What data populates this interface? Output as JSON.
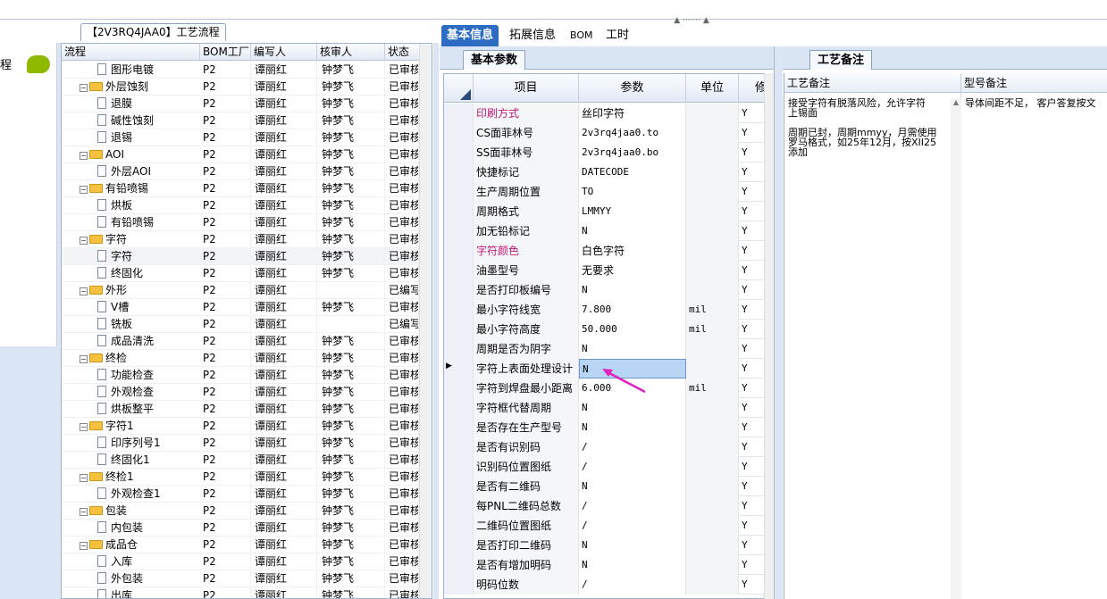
{
  "left_nav": {
    "title": "程"
  },
  "tree": {
    "tab_label": "【2V3RQ4JAA0】工艺流程",
    "columns": [
      "流程",
      "BOM工厂",
      "编写人",
      "核审人",
      "状态"
    ],
    "rows": [
      {
        "name": "图形电镀",
        "level": 2,
        "type": "doc",
        "bom": "P2",
        "writer": "谭丽红",
        "reviewer": "钟梦飞",
        "status": "已审核"
      },
      {
        "name": "外层蚀刻",
        "level": 1,
        "type": "folder",
        "bom": "P2",
        "writer": "谭丽红",
        "reviewer": "钟梦飞",
        "status": "已审核"
      },
      {
        "name": "退膜",
        "level": 2,
        "type": "doc",
        "bom": "P2",
        "writer": "谭丽红",
        "reviewer": "钟梦飞",
        "status": "已审核"
      },
      {
        "name": "碱性蚀刻",
        "level": 2,
        "type": "doc",
        "bom": "P2",
        "writer": "谭丽红",
        "reviewer": "钟梦飞",
        "status": "已审核"
      },
      {
        "name": "退锡",
        "level": 2,
        "type": "doc",
        "bom": "P2",
        "writer": "谭丽红",
        "reviewer": "钟梦飞",
        "status": "已审核"
      },
      {
        "name": "AOI",
        "level": 1,
        "type": "folder",
        "bom": "P2",
        "writer": "谭丽红",
        "reviewer": "钟梦飞",
        "status": "已审核"
      },
      {
        "name": "外层AOI",
        "level": 2,
        "type": "doc",
        "bom": "P2",
        "writer": "谭丽红",
        "reviewer": "钟梦飞",
        "status": "已审核"
      },
      {
        "name": "有铅喷锡",
        "level": 1,
        "type": "folder",
        "bom": "P2",
        "writer": "谭丽红",
        "reviewer": "钟梦飞",
        "status": "已审核"
      },
      {
        "name": "烘板",
        "level": 2,
        "type": "doc",
        "bom": "P2",
        "writer": "谭丽红",
        "reviewer": "钟梦飞",
        "status": "已审核"
      },
      {
        "name": "有铅喷锡",
        "level": 2,
        "type": "doc",
        "bom": "P2",
        "writer": "谭丽红",
        "reviewer": "钟梦飞",
        "status": "已审核"
      },
      {
        "name": "字符",
        "level": 1,
        "type": "folder",
        "bom": "P2",
        "writer": "谭丽红",
        "reviewer": "钟梦飞",
        "status": "已审核"
      },
      {
        "name": "字符",
        "level": 2,
        "type": "doc",
        "bom": "P2",
        "writer": "谭丽红",
        "reviewer": "钟梦飞",
        "status": "已审核",
        "selected": true
      },
      {
        "name": "终固化",
        "level": 2,
        "type": "doc",
        "bom": "P2",
        "writer": "谭丽红",
        "reviewer": "钟梦飞",
        "status": "已审核"
      },
      {
        "name": "外形",
        "level": 1,
        "type": "folder",
        "bom": "P2",
        "writer": "谭丽红",
        "reviewer": "",
        "status": "已编写"
      },
      {
        "name": "V槽",
        "level": 2,
        "type": "doc",
        "bom": "P2",
        "writer": "谭丽红",
        "reviewer": "钟梦飞",
        "status": "已审核"
      },
      {
        "name": "铣板",
        "level": 2,
        "type": "doc",
        "bom": "P2",
        "writer": "谭丽红",
        "reviewer": "",
        "status": "已编写"
      },
      {
        "name": "成品清洗",
        "level": 2,
        "type": "doc",
        "bom": "P2",
        "writer": "谭丽红",
        "reviewer": "钟梦飞",
        "status": "已审核"
      },
      {
        "name": "终检",
        "level": 1,
        "type": "folder",
        "bom": "P2",
        "writer": "谭丽红",
        "reviewer": "钟梦飞",
        "status": "已审核"
      },
      {
        "name": "功能检查",
        "level": 2,
        "type": "doc",
        "bom": "P2",
        "writer": "谭丽红",
        "reviewer": "钟梦飞",
        "status": "已审核"
      },
      {
        "name": "外观检查",
        "level": 2,
        "type": "doc",
        "bom": "P2",
        "writer": "谭丽红",
        "reviewer": "钟梦飞",
        "status": "已审核"
      },
      {
        "name": "烘板整平",
        "level": 2,
        "type": "doc",
        "bom": "P2",
        "writer": "谭丽红",
        "reviewer": "钟梦飞",
        "status": "已审核"
      },
      {
        "name": "字符1",
        "level": 1,
        "type": "folder",
        "bom": "P2",
        "writer": "谭丽红",
        "reviewer": "钟梦飞",
        "status": "已审核"
      },
      {
        "name": "印序列号1",
        "level": 2,
        "type": "doc",
        "bom": "P2",
        "writer": "谭丽红",
        "reviewer": "钟梦飞",
        "status": "已审核"
      },
      {
        "name": "终固化1",
        "level": 2,
        "type": "doc",
        "bom": "P2",
        "writer": "谭丽红",
        "reviewer": "钟梦飞",
        "status": "已审核"
      },
      {
        "name": "终检1",
        "level": 1,
        "type": "folder",
        "bom": "P2",
        "writer": "谭丽红",
        "reviewer": "钟梦飞",
        "status": "已审核"
      },
      {
        "name": "外观检查1",
        "level": 2,
        "type": "doc",
        "bom": "P2",
        "writer": "谭丽红",
        "reviewer": "钟梦飞",
        "status": "已审核"
      },
      {
        "name": "包装",
        "level": 1,
        "type": "folder",
        "bom": "P2",
        "writer": "谭丽红",
        "reviewer": "钟梦飞",
        "status": "已审核"
      },
      {
        "name": "内包装",
        "level": 2,
        "type": "doc",
        "bom": "P2",
        "writer": "谭丽红",
        "reviewer": "钟梦飞",
        "status": "已审核"
      },
      {
        "name": "成品仓",
        "level": 1,
        "type": "folder",
        "bom": "P2",
        "writer": "谭丽红",
        "reviewer": "钟梦飞",
        "status": "已审核"
      },
      {
        "name": "入库",
        "level": 2,
        "type": "doc",
        "bom": "P2",
        "writer": "谭丽红",
        "reviewer": "钟梦飞",
        "status": "已审核"
      },
      {
        "name": "外包装",
        "level": 2,
        "type": "doc",
        "bom": "P2",
        "writer": "谭丽红",
        "reviewer": "钟梦飞",
        "status": "已审核"
      },
      {
        "name": "出库",
        "level": 2,
        "type": "doc",
        "bom": "P2",
        "writer": "谭丽红",
        "reviewer": "钟梦飞",
        "status": "已审核"
      }
    ]
  },
  "main_tabs": [
    "基本信息",
    "拓展信息",
    "BOM",
    "工时"
  ],
  "sub_tab": "基本参数",
  "grid": {
    "columns": [
      "项目",
      "参数",
      "单位",
      "修"
    ],
    "rows": [
      {
        "item": "印刷方式",
        "param": "丝印字符",
        "unit": "",
        "flag": "Y",
        "highlight": true
      },
      {
        "item": "CS面菲林号",
        "param": "2v3rq4jaa0.to",
        "unit": "",
        "flag": "Y"
      },
      {
        "item": "SS面菲林号",
        "param": "2v3rq4jaa0.bo",
        "unit": "",
        "flag": "Y"
      },
      {
        "item": "快捷标记",
        "param": "DATECODE",
        "unit": "",
        "flag": "Y"
      },
      {
        "item": "生产周期位置",
        "param": "TO",
        "unit": "",
        "flag": "Y"
      },
      {
        "item": "周期格式",
        "param": "LMMYY",
        "unit": "",
        "flag": "Y"
      },
      {
        "item": "加无铅标记",
        "param": "N",
        "unit": "",
        "flag": "Y"
      },
      {
        "item": "字符颜色",
        "param": "白色字符",
        "unit": "",
        "flag": "Y",
        "highlight": true
      },
      {
        "item": "油墨型号",
        "param": "无要求",
        "unit": "",
        "flag": "Y"
      },
      {
        "item": "是否打印板编号",
        "param": "N",
        "unit": "",
        "flag": "Y"
      },
      {
        "item": "最小字符线宽",
        "param": "7.800",
        "unit": "mil",
        "flag": "Y"
      },
      {
        "item": "最小字符高度",
        "param": "50.000",
        "unit": "mil",
        "flag": "Y"
      },
      {
        "item": "周期是否为阴字",
        "param": "N",
        "unit": "",
        "flag": "Y"
      },
      {
        "item": "字符上表面处理设计",
        "param": "N",
        "unit": "",
        "flag": "Y",
        "selected": true
      },
      {
        "item": "字符到焊盘最小距离",
        "param": "6.000",
        "unit": "mil",
        "flag": "Y"
      },
      {
        "item": "字符框代替周期",
        "param": "N",
        "unit": "",
        "flag": "Y"
      },
      {
        "item": "是否存在生产型号",
        "param": "N",
        "unit": "",
        "flag": "Y"
      },
      {
        "item": "是否有识别码",
        "param": "/",
        "unit": "",
        "flag": "Y"
      },
      {
        "item": "识别码位置图纸",
        "param": "/",
        "unit": "",
        "flag": "Y"
      },
      {
        "item": "是否有二维码",
        "param": "N",
        "unit": "",
        "flag": "Y"
      },
      {
        "item": "每PNL二维码总数",
        "param": "/",
        "unit": "",
        "flag": "Y"
      },
      {
        "item": "二维码位置图纸",
        "param": "/",
        "unit": "",
        "flag": "Y"
      },
      {
        "item": "是否打印二维码",
        "param": "N",
        "unit": "",
        "flag": "Y"
      },
      {
        "item": "是否有增加明码",
        "param": "N",
        "unit": "",
        "flag": "Y"
      },
      {
        "item": "明码位数",
        "param": "/",
        "unit": "",
        "flag": "Y"
      }
    ]
  },
  "remarks": {
    "tab": "工艺备注",
    "col1_header": "工艺备注",
    "col2_header": "型号备注",
    "col1_text": "接受字符有脱落风险，允许字符\n上锡面\n\n周期已封，周期mmyy，月需使用\n罗马格式，如25年12月，按XII25\n添加",
    "col2_text": "导体间距不足， 客户答复按文"
  },
  "colors": {
    "accent": "#2c6cc2",
    "highlight_text": "#c0187a",
    "annotation_arrow": "#e020c0"
  }
}
